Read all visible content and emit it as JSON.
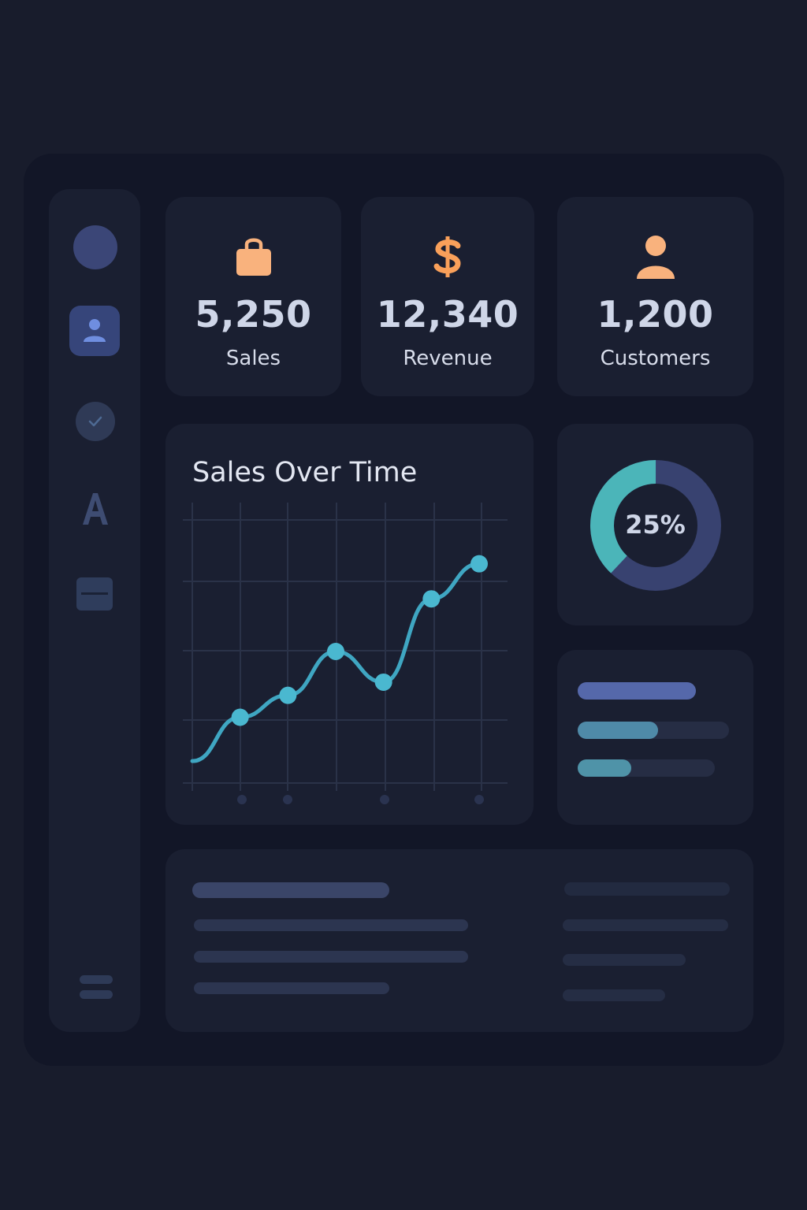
{
  "theme": {
    "accent_orange": "#f9b27d",
    "line_color": "#3fa6c2",
    "donut_fill": "#4bb5b9",
    "donut_track": "#384270"
  },
  "sidebar": {
    "icons": [
      "avatar-circle",
      "user-icon",
      "check-icon",
      "font-icon",
      "card-icon",
      "menu-icon"
    ]
  },
  "stats": [
    {
      "icon": "shopping-bag-icon",
      "value": "5,250",
      "label": "Sales"
    },
    {
      "icon": "dollar-icon",
      "value": "12,340",
      "label": "Revenue"
    },
    {
      "icon": "user-icon",
      "value": "1,200",
      "label": "Customers"
    }
  ],
  "sales_chart": {
    "title": "Sales Over Time"
  },
  "chart_data": {
    "type": "line",
    "title": "Sales Over Time",
    "x": [
      0,
      1,
      2,
      3,
      4,
      5,
      6
    ],
    "values": [
      5,
      15,
      20,
      30,
      23,
      42,
      50
    ],
    "ylim": [
      0,
      60
    ],
    "grid": true
  },
  "donut": {
    "value": 25,
    "label": "25%"
  },
  "progress_bars": [
    {
      "fraction": 1.0,
      "color": "#5568aa"
    },
    {
      "fraction": 0.53,
      "color": "#4f8aa8"
    },
    {
      "fraction": 0.39,
      "color": "#4f93a8"
    }
  ]
}
